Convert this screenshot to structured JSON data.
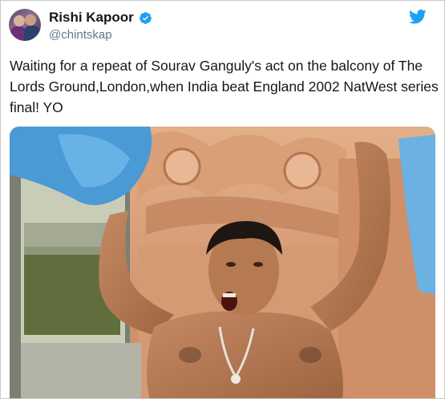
{
  "tweet": {
    "author_name": "Rishi Kapoor",
    "author_handle": "@chintskap",
    "verified": true,
    "text": "Waiting for a repeat of Sourav Ganguly's act on the balcony of The Lords Ground,London,when India beat England 2002 NatWest series final! YO"
  },
  "icons": {
    "verified": "verified-badge-icon",
    "brand": "twitter-bird-icon"
  },
  "colors": {
    "twitter_blue": "#1da1f2",
    "name_text": "#14171a",
    "handle_text": "#657786"
  }
}
